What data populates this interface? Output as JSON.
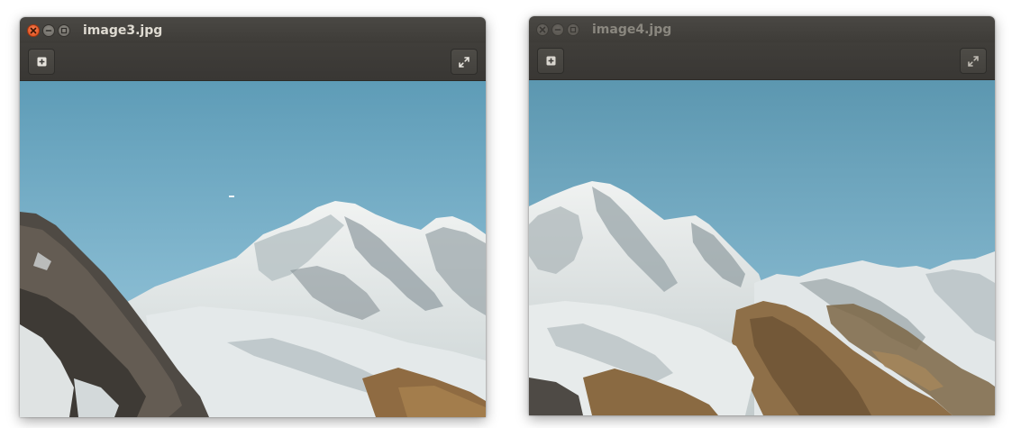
{
  "windows": [
    {
      "title": "image3.jpg",
      "state": "active",
      "controls": {
        "close_icon": "close-icon",
        "minimize_icon": "minimize-icon",
        "maximize_icon": "maximize-icon"
      },
      "toolbar": {
        "add_icon": "plus-icon",
        "fullscreen_icon": "fullscreen-icon"
      }
    },
    {
      "title": "image4.jpg",
      "state": "inactive",
      "controls": {
        "close_icon": "close-icon",
        "minimize_icon": "minimize-icon",
        "maximize_icon": "maximize-icon"
      },
      "toolbar": {
        "add_icon": "plus-icon",
        "fullscreen_icon": "fullscreen-icon"
      }
    }
  ],
  "colors": {
    "titlebar": "#45433f",
    "toolbar": "#3c3a37",
    "close_active": "#e95420",
    "sky_top": "#5f9bb5",
    "sky_bottom": "#8ec0d5",
    "snow": "#e8ecec",
    "rock_dark": "#4a4540",
    "rock_brown": "#8a6a44"
  }
}
